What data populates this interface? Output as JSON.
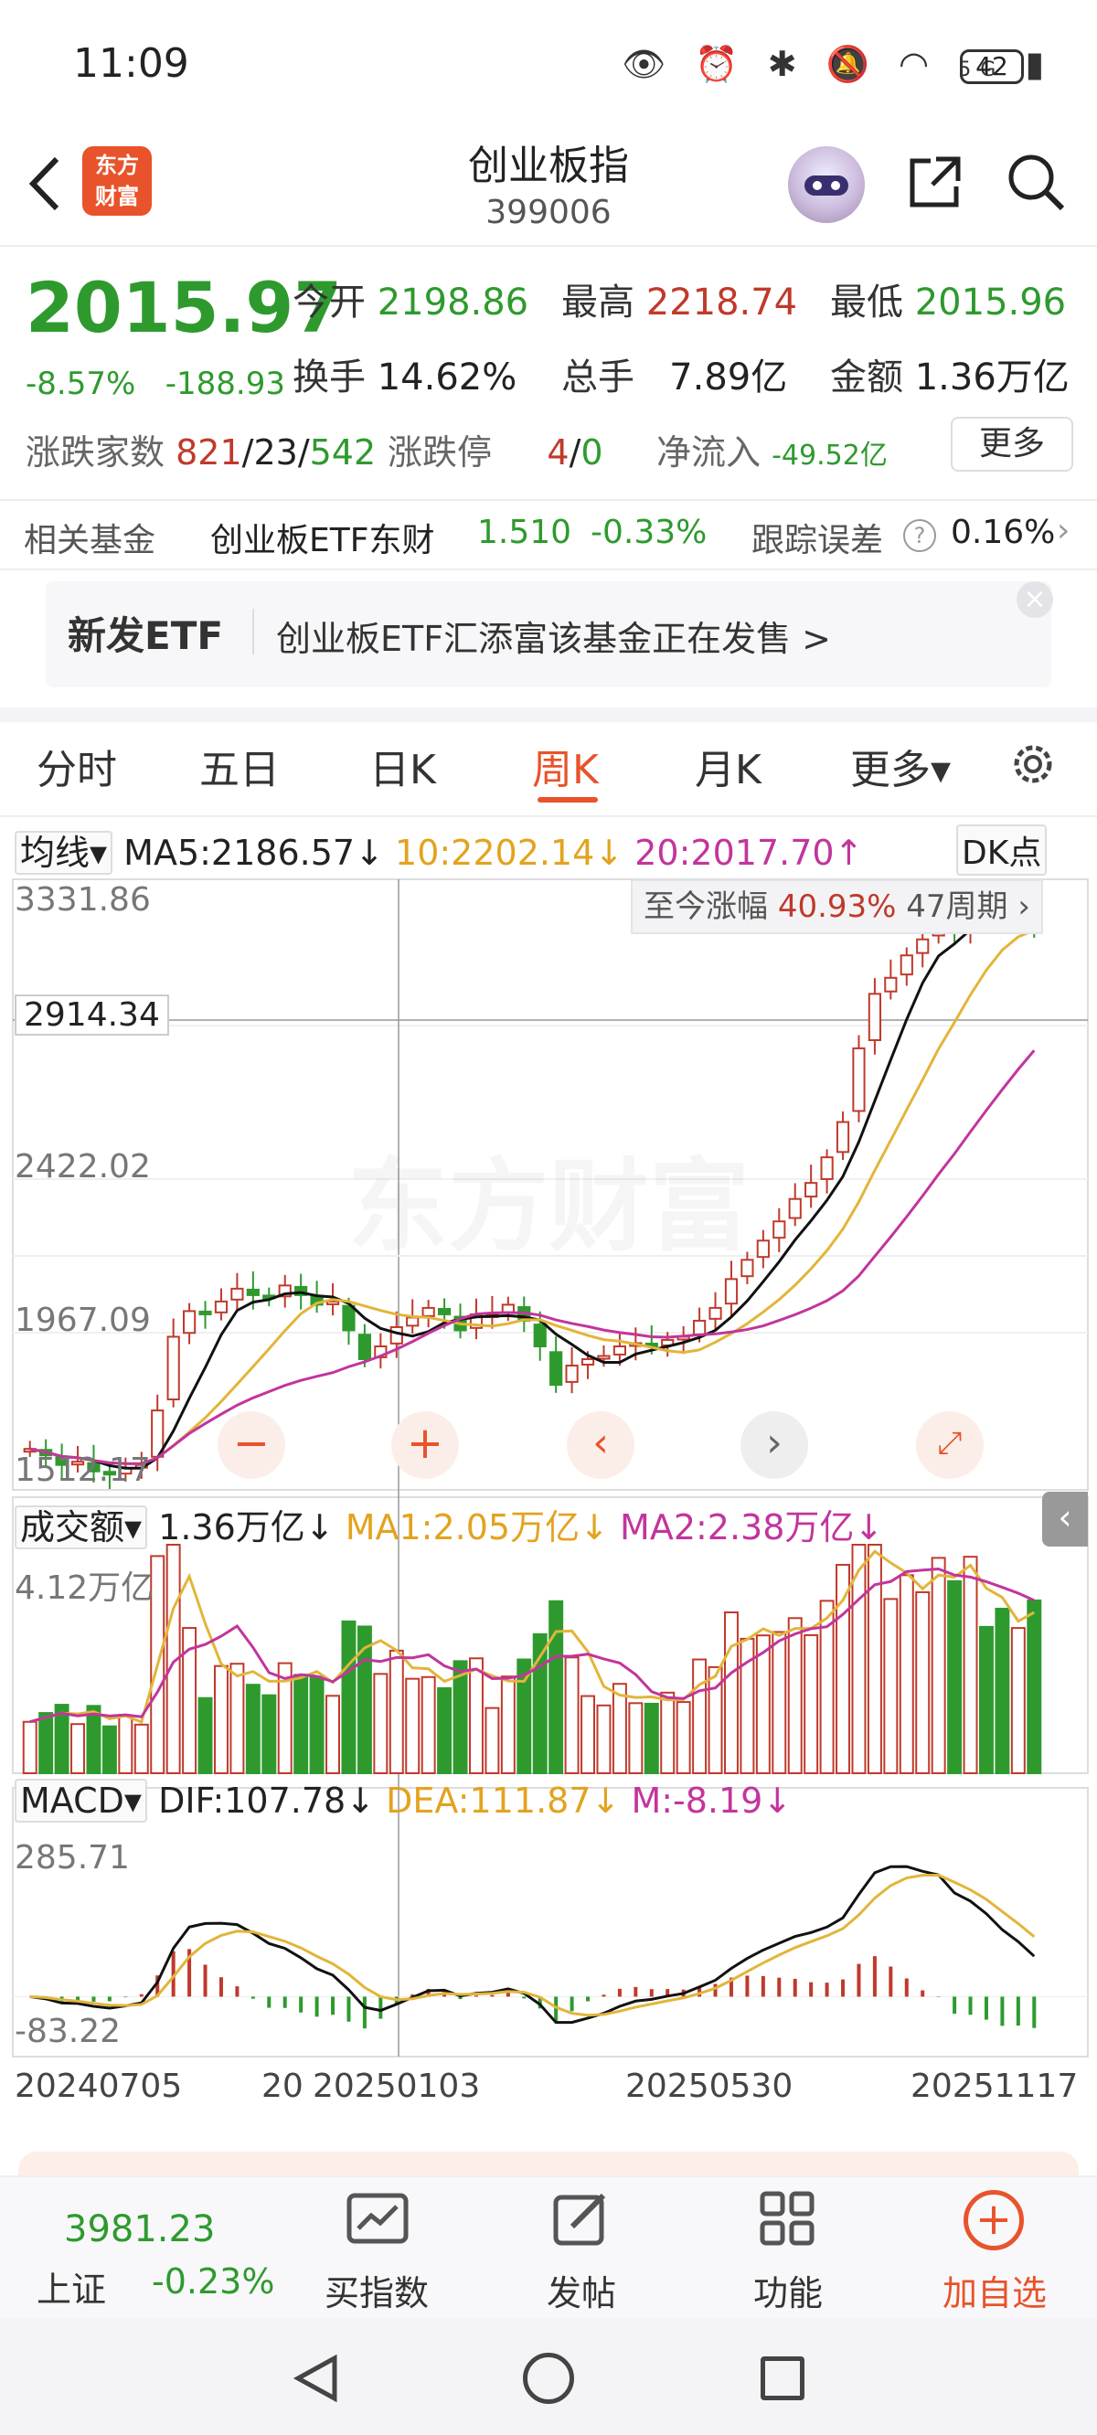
{
  "status": {
    "time": "11:09",
    "battery": "42",
    "network": "5G"
  },
  "header": {
    "title": "创业板指",
    "code": "399006",
    "logo_line1": "东方",
    "logo_line2": "财富"
  },
  "quote": {
    "price": "2015.97",
    "change_pct": "-8.57%",
    "change_abs": "-188.93",
    "open_label": "今开",
    "open": "2198.86",
    "high_label": "最高",
    "high": "2218.74",
    "low_label": "最低",
    "low": "2015.96",
    "turnover_label": "换手",
    "turnover": "14.62%",
    "volume_label": "总手",
    "volume": "7.89亿",
    "amount_label": "金额",
    "amount": "1.36万亿",
    "breadth_label": "涨跌家数",
    "breadth_up": "821",
    "breadth_flat": "23",
    "breadth_down": "542",
    "limit_label": "涨跌停",
    "limit_up": "4",
    "limit_down": "0",
    "inflow_label": "净流入",
    "inflow": "-49.52亿",
    "more": "更多"
  },
  "fund": {
    "label": "相关基金",
    "name": "创业板ETF东财",
    "price": "1.510",
    "pct": "-0.33%",
    "track_label": "跟踪误差",
    "track": "0.16%"
  },
  "etf_banner": {
    "badge": "新发ETF",
    "text": "创业板ETF汇添富该基金正在发售  >"
  },
  "tabs": [
    "分时",
    "五日",
    "日K",
    "周K",
    "月K",
    "更多▾"
  ],
  "ma_row": {
    "select": "均线▾",
    "ma5": "MA5:2186.57↓",
    "ma10": "10:2202.14↓",
    "ma20": "20:2017.70↑",
    "dk": "DK点"
  },
  "price_panel": {
    "y_labels": [
      "3331.86",
      "2422.02",
      "1967.09",
      "1512.17"
    ],
    "crosshair_value": "2914.34",
    "gain_label": "至今涨幅",
    "gain_value": "40.93%",
    "gain_period": "47周期 ›",
    "watermark": "东方财富"
  },
  "vol_row": {
    "select": "成交额▾",
    "value": "1.36万亿↓",
    "ma1": "MA1:2.05万亿↓",
    "ma2": "MA2:2.38万亿↓",
    "y_top": "4.12万亿"
  },
  "macd_row": {
    "select": "MACD▾",
    "dif": "DIF:107.78↓",
    "dea": "DEA:111.87↓",
    "m": "M:-8.19↓",
    "y_top": "285.71",
    "y_bottom": "-83.22"
  },
  "x_labels": [
    "20240705",
    "20",
    "20250103",
    "20250530",
    "20251117"
  ],
  "bottom": {
    "index_value": "3981.23",
    "index_name": "上证",
    "index_pct": "-0.23%",
    "buy": "买指数",
    "post": "发帖",
    "func": "功能",
    "add": "加自选"
  },
  "colors": {
    "up": "#c0392b",
    "down": "#2e9a2e",
    "ma5": "#111111",
    "ma10": "#e2b53a",
    "ma20": "#c2359c",
    "accent": "#e8532b"
  },
  "chart_data": {
    "type": "candlestick",
    "period": "weekly",
    "y_range": [
      1512.17,
      3331.86
    ],
    "closes": [
      1640,
      1620,
      1590,
      1600,
      1570,
      1560,
      1580,
      1590,
      1760,
      1990,
      2070,
      2060,
      2100,
      2140,
      2120,
      2110,
      2150,
      2120,
      2090,
      2100,
      2010,
      1920,
      1960,
      2020,
      2050,
      2080,
      2060,
      2010,
      2060,
      2060,
      2090,
      2040,
      1960,
      1840,
      1900,
      1920,
      1930,
      1960,
      1970,
      1960,
      1980,
      1990,
      2040,
      2080,
      2170,
      2230,
      2290,
      2350,
      2420,
      2470,
      2550,
      2660,
      2890,
      3060,
      3110,
      3180,
      3230,
      3310,
      3250,
      3330,
      3320,
      3290,
      3300,
      3260
    ],
    "volume_y_top": "4.12万亿",
    "macd_range": [
      -83.22,
      285.71
    ]
  }
}
